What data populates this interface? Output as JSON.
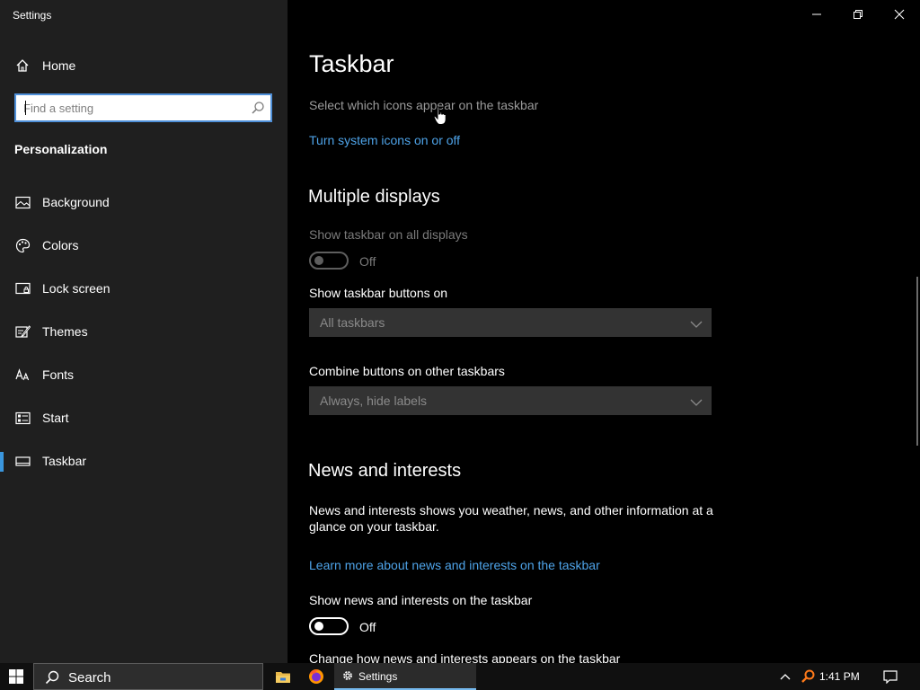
{
  "sidebar": {
    "app_title": "Settings",
    "home_label": "Home",
    "search_placeholder": "Find a setting",
    "section_label": "Personalization",
    "items": [
      {
        "label": "Background",
        "icon": "image-icon"
      },
      {
        "label": "Colors",
        "icon": "palette-icon"
      },
      {
        "label": "Lock screen",
        "icon": "lock-screen-icon"
      },
      {
        "label": "Themes",
        "icon": "themes-icon"
      },
      {
        "label": "Fonts",
        "icon": "fonts-icon"
      },
      {
        "label": "Start",
        "icon": "start-icon"
      },
      {
        "label": "Taskbar",
        "icon": "taskbar-icon",
        "active": true
      }
    ]
  },
  "main": {
    "title": "Taskbar",
    "icons_text": "Select which icons appear on the taskbar",
    "system_icons_link": "Turn system icons on or off",
    "multiple_displays": {
      "heading": "Multiple displays",
      "show_all_label": "Show taskbar on all displays",
      "show_all_state": "Off",
      "buttons_on_label": "Show taskbar buttons on",
      "buttons_on_value": "All taskbars",
      "combine_label": "Combine buttons on other taskbars",
      "combine_value": "Always, hide labels"
    },
    "news": {
      "heading": "News and interests",
      "description_line1": "News and interests shows you weather, news, and other information at a",
      "description_line2": "glance on your taskbar.",
      "learn_more_link": "Learn more about news and interests on the taskbar",
      "show_label": "Show news and interests on the taskbar",
      "show_state": "Off",
      "change_label": "Change how news and interests appears on the taskbar"
    }
  },
  "taskbar": {
    "search_label": "Search",
    "active_app_label": "Settings",
    "time": "1:41 PM"
  },
  "colors": {
    "accent": "#3a96dd",
    "link": "#4ea3e8",
    "sidebar_bg": "#1f1f1f",
    "main_bg": "#000000"
  }
}
